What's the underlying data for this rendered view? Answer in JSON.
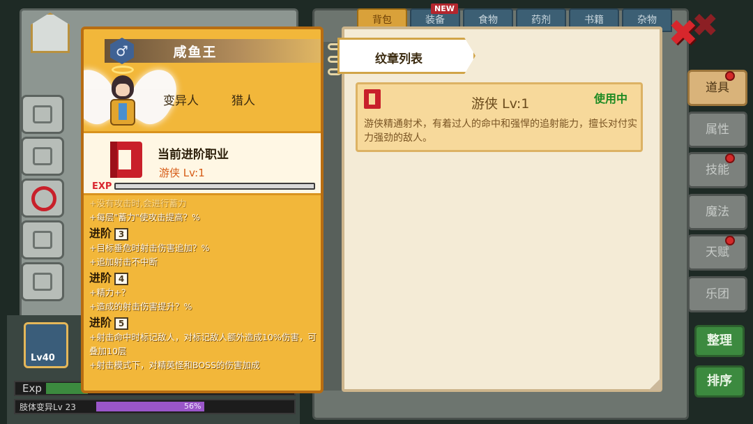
{
  "top_tabs": [
    {
      "label": "背包",
      "active": true
    },
    {
      "label": "装备",
      "active": false
    },
    {
      "label": "食物",
      "active": false
    },
    {
      "label": "药剂",
      "active": false
    },
    {
      "label": "书籍",
      "active": false
    },
    {
      "label": "杂物",
      "active": false
    }
  ],
  "new_tag": "NEW",
  "side_tabs": [
    {
      "label": "道具",
      "active": true,
      "dot": true
    },
    {
      "label": "属性",
      "active": false,
      "dot": false
    },
    {
      "label": "技能",
      "active": false,
      "dot": true
    },
    {
      "label": "魔法",
      "active": false,
      "dot": false
    },
    {
      "label": "天赋",
      "active": false,
      "dot": true
    },
    {
      "label": "乐团",
      "active": false,
      "dot": false
    }
  ],
  "action_buttons": {
    "sort_label": "整理",
    "order_label": "排序"
  },
  "character": {
    "name": "咸鱼王",
    "gender_symbol": "♂",
    "traits": [
      "变异人",
      "猎人"
    ],
    "class_box_title": "当前进阶职业",
    "class_name": "游侠 Lv:1",
    "exp_label": "EXP"
  },
  "skills": {
    "line0": "+没有攻击时,会进行蓄力",
    "line1": "+每层\"蓄力\"使攻击提高？%",
    "stage3_label": "进阶",
    "stage3_num": "3",
    "line2": "+目标垂危时射击伤害追加？%",
    "line3": "+追加射击不中断",
    "stage4_label": "进阶",
    "stage4_num": "4",
    "line4": "+精力+？",
    "line5": "+造成的射击伤害提升？%",
    "stage5_label": "进阶",
    "stage5_num": "5",
    "line6": "+射击命中时标记敌人，对标记敌人额外造成10%伤害，可叠加10层",
    "line7": "+射击模式下，对精英怪和BOSS的伤害加成"
  },
  "badge_panel": {
    "header": "纹章列表",
    "card_title": "游侠 Lv:1",
    "card_status": "使用中",
    "card_desc": "游侠精通射术，有着过人的命中和强悍的追射能力，擅长对付实力强劲的敌人。"
  },
  "bottom_card": {
    "level": "Lv40",
    "exp_label": "Exp",
    "mutation_label": "肢体变异Lv 23",
    "mutation_percent": "56%",
    "mutation_progress": 0.56
  },
  "colors": {
    "panel_gold": "#f2b73a",
    "class_red": "#c9202a",
    "status_green": "#1d8a22"
  }
}
